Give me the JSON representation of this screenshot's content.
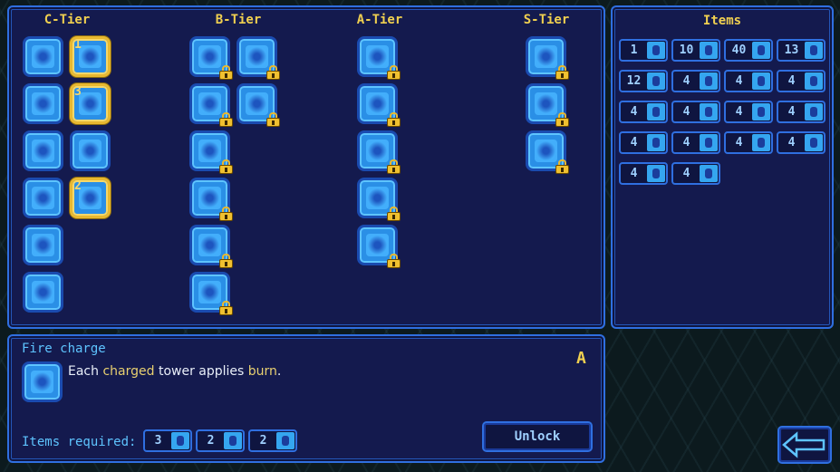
{
  "tiers": [
    {
      "title": "C-Tier",
      "skills": [
        {
          "icon": "battery-skill-icon",
          "owned": false
        },
        {
          "icon": "drum-skill-icon",
          "owned": true,
          "level": "1"
        },
        {
          "icon": "burst-skill-icon",
          "owned": false
        },
        {
          "icon": "web-skill-icon",
          "owned": true,
          "level": "3"
        },
        {
          "icon": "slot-machine-skill-icon",
          "owned": false
        },
        {
          "icon": "circuit-skill-icon",
          "owned": false
        },
        {
          "icon": "sun-skill-icon",
          "owned": false
        },
        {
          "icon": "wave-skill-icon",
          "owned": true,
          "level": "2"
        },
        {
          "icon": "brain-skill-icon",
          "owned": false
        },
        {
          "icon": "percent-skill-icon",
          "owned": false
        }
      ]
    },
    {
      "title": "B-Tier",
      "skills": [
        {
          "icon": "splash-skill-icon",
          "locked": true
        },
        {
          "icon": "explosion-skill-icon",
          "locked": true
        },
        {
          "icon": "web-skill-icon",
          "locked": true
        },
        {
          "icon": "lightning-skill-icon",
          "locked": true
        },
        {
          "icon": "compass-skill-icon",
          "locked": true
        },
        {
          "icon": "gear-skill-icon",
          "locked": true
        },
        {
          "icon": "chest-skill-icon",
          "locked": true
        },
        {
          "icon": "flame-skill-icon",
          "locked": true
        }
      ]
    },
    {
      "title": "A-Tier",
      "skills": [
        {
          "icon": "spark-skill-icon",
          "locked": true
        },
        {
          "icon": "claw-skill-icon",
          "locked": true
        },
        {
          "icon": "ring-skill-icon",
          "locked": true
        },
        {
          "icon": "shield-skill-icon",
          "locked": true
        },
        {
          "icon": "fire-charge-skill-icon",
          "locked": true
        }
      ]
    },
    {
      "title": "S-Tier",
      "skills": [
        {
          "icon": "mask-skill-icon",
          "locked": true
        },
        {
          "icon": "pillar-skill-icon",
          "locked": true
        },
        {
          "icon": "crystal-skill-icon",
          "locked": true
        }
      ]
    }
  ],
  "items_panel": {
    "title": "Items",
    "items": [
      {
        "count": "1",
        "icon": "statue-icon"
      },
      {
        "count": "10",
        "icon": "brain-icon"
      },
      {
        "count": "40",
        "icon": "gate-icon"
      },
      {
        "count": "13",
        "icon": "chest-icon"
      },
      {
        "count": "12",
        "icon": "orb-icon"
      },
      {
        "count": "4",
        "icon": "bug-icon"
      },
      {
        "count": "4",
        "icon": "crystal-icon"
      },
      {
        "count": "4",
        "icon": "scroll-icon"
      },
      {
        "count": "4",
        "icon": "spring-icon"
      },
      {
        "count": "4",
        "icon": "sun-icon"
      },
      {
        "count": "4",
        "icon": "wave-icon"
      },
      {
        "count": "4",
        "icon": "feather-icon"
      },
      {
        "count": "4",
        "icon": "vortex-icon"
      },
      {
        "count": "4",
        "icon": "crab-icon"
      },
      {
        "count": "4",
        "icon": "drop-icon"
      },
      {
        "count": "4",
        "icon": "parchment-icon"
      },
      {
        "count": "4",
        "icon": "shield-icon"
      },
      {
        "count": "4",
        "icon": "claw-icon"
      }
    ]
  },
  "detail": {
    "name": "Fire charge",
    "tier": "A",
    "desc_parts": [
      {
        "text": "Each ",
        "hl": false
      },
      {
        "text": "charged",
        "hl": true
      },
      {
        "text": " tower applies ",
        "hl": false
      },
      {
        "text": "burn",
        "hl": true
      },
      {
        "text": ".",
        "hl": false
      }
    ],
    "required_label": "Items required:",
    "required": [
      {
        "count": "3",
        "icon": "spring-icon"
      },
      {
        "count": "2",
        "icon": "parchment-icon"
      },
      {
        "count": "2",
        "icon": "claw-icon"
      }
    ],
    "unlock_label": "Unlock"
  },
  "colors": {
    "highlight": "#e8d070",
    "title": "#f0d050",
    "panel": "#141a4e",
    "border": "#2f6fe0"
  }
}
